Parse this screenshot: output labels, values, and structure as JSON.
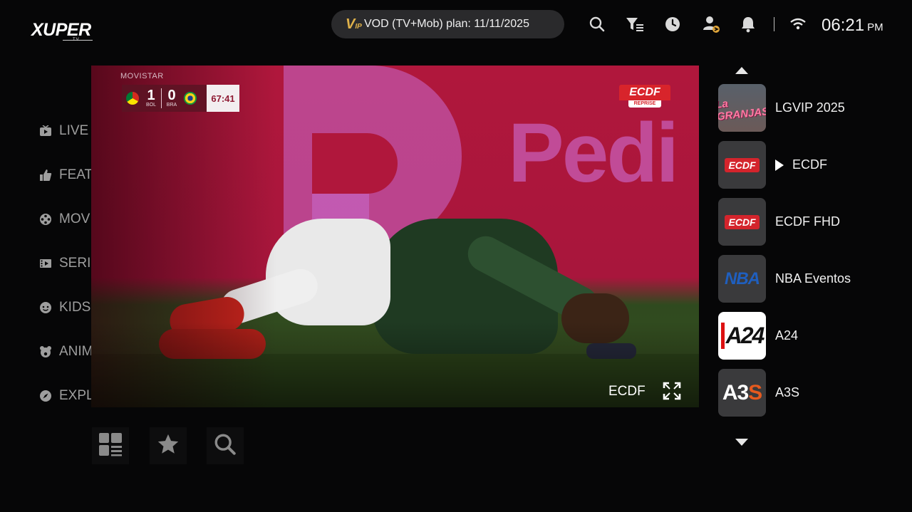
{
  "app": {
    "logo_text": "XUPER",
    "logo_sub": "TV"
  },
  "header": {
    "plan_badge_icon": "vip-icon",
    "plan_text": "VOD (TV+Mob) plan: 11/11/2025",
    "icons": [
      "search-icon",
      "filter-list-icon",
      "history-clock-icon",
      "account-switch-icon",
      "bell-icon",
      "wifi-icon"
    ],
    "time": "06:21",
    "ampm": "PM"
  },
  "sidebar": {
    "items": [
      {
        "label": "LIVE",
        "icon": "tv-icon"
      },
      {
        "label": "FEATURED",
        "icon": "thumbs-up-icon"
      },
      {
        "label": "MOVIES",
        "icon": "film-reel-icon"
      },
      {
        "label": "SERIES",
        "icon": "series-icon"
      },
      {
        "label": "KIDS",
        "icon": "kid-face-icon"
      },
      {
        "label": "ANIME",
        "icon": "bear-icon"
      },
      {
        "label": "EXPLORAR",
        "icon": "compass-icon"
      }
    ]
  },
  "player": {
    "broadcaster": "MOVISTAR",
    "score": {
      "home_team": "BOL",
      "home_score": "1",
      "away_team": "BRA",
      "away_score": "0",
      "match_clock": "67:41"
    },
    "channel_logo_top": "ECDF",
    "channel_logo_bottom": "REPRISE",
    "background_sign": "Pedi",
    "channel_name": "ECDF"
  },
  "tools": [
    "grid-layout-icon",
    "star-icon",
    "search-icon"
  ],
  "channels": [
    {
      "name": "LGVIP 2025",
      "thumb_text": "La GRANJAS",
      "playing": false
    },
    {
      "name": "ECDF",
      "thumb_text": "ECDF",
      "playing": true
    },
    {
      "name": "ECDF FHD",
      "thumb_text": "ECDF",
      "playing": false
    },
    {
      "name": "NBA Eventos",
      "thumb_text": "NBA",
      "playing": false
    },
    {
      "name": "A24",
      "thumb_text": "A24",
      "playing": false
    },
    {
      "name": "A3S",
      "thumb_text_main": "A3",
      "thumb_text_accent": "S",
      "playing": false
    }
  ],
  "colors": {
    "background": "#060607",
    "pill": "#2a2a2c",
    "vip_gold": "#e0b24a",
    "ecdf_red": "#d4242c",
    "nav_text": "#9e9e9e"
  }
}
